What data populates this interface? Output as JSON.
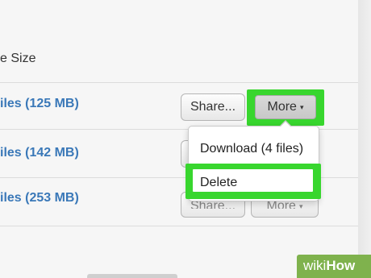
{
  "table": {
    "size_header": "e Size",
    "rows": [
      {
        "label": "iles (125 MB)"
      },
      {
        "label": "iles (142 MB)"
      },
      {
        "label": "iles (253 MB)"
      }
    ]
  },
  "buttons": {
    "share_label": "Share...",
    "more_label": "More",
    "caret_icon": "▾"
  },
  "dropdown": {
    "items": [
      {
        "label": "Download (4 files)"
      },
      {
        "label": "Delete"
      }
    ]
  },
  "watermark": {
    "wiki": "wiki",
    "how": "How"
  },
  "colors": {
    "highlight": "#38d62e",
    "file_link": "#3a78b8",
    "watermark_bg": "#7fb24d"
  }
}
